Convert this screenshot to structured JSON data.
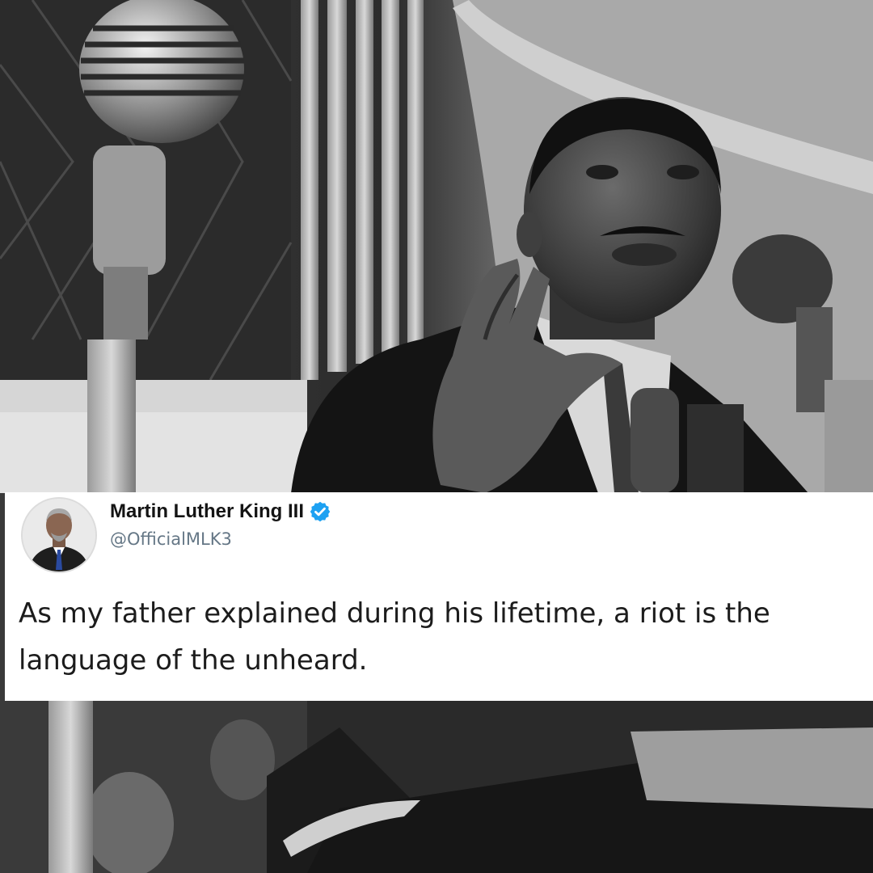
{
  "tweet": {
    "display_name": "Martin Luther King III",
    "handle": "@OfficialMLK3",
    "text": "As my father explained during his lifetime, a riot is the language of the unheard.",
    "verified": true
  },
  "icons": {
    "verified": "verified-badge-icon",
    "avatar": "profile-avatar"
  },
  "colors": {
    "verified_badge": "#1da1f2",
    "handle_text": "#657786",
    "card_background": "#ffffff"
  }
}
